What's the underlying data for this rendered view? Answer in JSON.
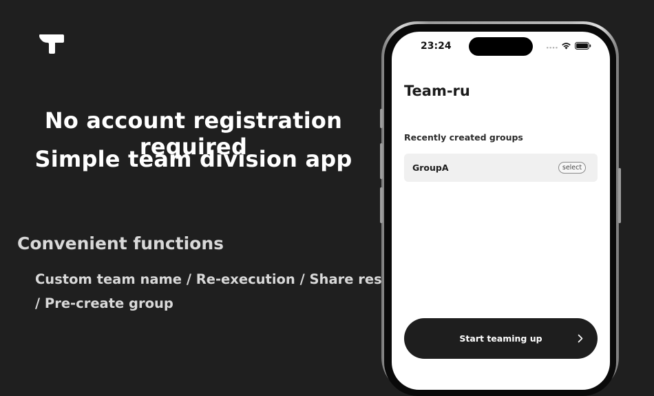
{
  "headline": {
    "line1": "No account registration required",
    "line2": "Simple team division app"
  },
  "features": {
    "title": "Convenient functions",
    "line1": "Custom team name / Re-execution / Share results",
    "line2": "/ Pre-create group"
  },
  "status_bar": {
    "time": "23:24",
    "icons": [
      "cellular-signal-icon",
      "wifi-icon",
      "battery-icon"
    ]
  },
  "app": {
    "title": "Team-ru",
    "recent_label": "Recently created groups",
    "groups": [
      {
        "name": "GroupA",
        "action": "select"
      }
    ],
    "start_button": "Start teaming up"
  },
  "colors": {
    "background": "#1f1f1f",
    "primary_button": "#1e1e1e",
    "group_row": "#f0f0f0"
  }
}
